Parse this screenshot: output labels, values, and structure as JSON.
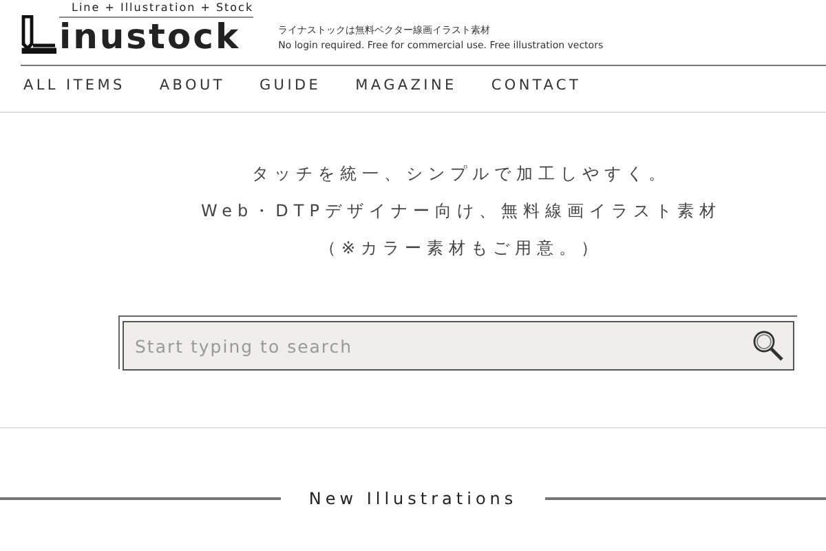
{
  "logo": {
    "tagline": "Line + Illustration + Stock",
    "name": "inustock"
  },
  "site_description": [
    "ライナストックは無料ベクター線画イラスト素材",
    "No login required. Free for commercial use. Free illustration vectors"
  ],
  "nav": [
    "ALL ITEMS",
    "ABOUT",
    "GUIDE",
    "MAGAZINE",
    "CONTACT"
  ],
  "intro": [
    "タッチを統一、シンプルで加工しやすく。",
    "Web・DTPデザイナー向け、無料線画イラスト素材",
    "（※カラー素材もご用意。）"
  ],
  "search": {
    "placeholder": "Start typing to search"
  },
  "section_heading": "New Illustrations"
}
